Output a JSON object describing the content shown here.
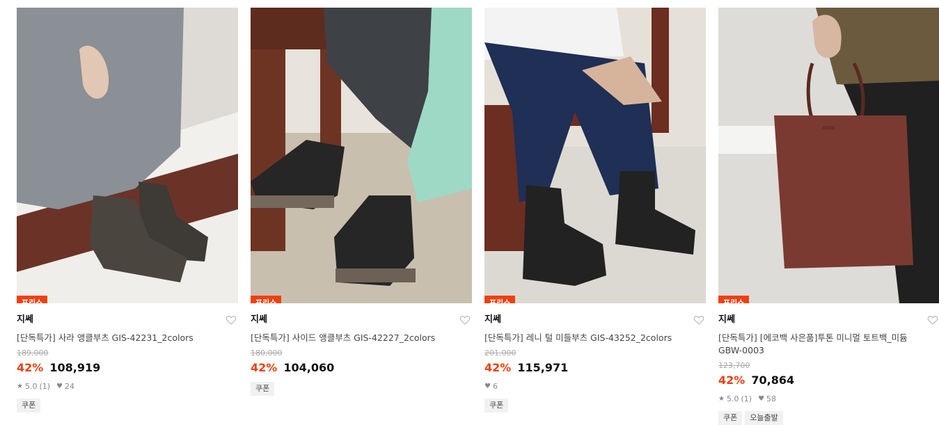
{
  "products": [
    {
      "badge": "프리쇼",
      "brand": "지쎄",
      "name": "[단독특가] 사라 앵클부츠 GIS-42231_2colors",
      "original_price": "189,000",
      "discount": "42%",
      "price": "108,919",
      "rating": "5.0",
      "review_count": "(1)",
      "likes": "24",
      "tags": [
        "쿠폰"
      ],
      "heart_icon": "heart-outline-icon"
    },
    {
      "badge": "프리쇼",
      "brand": "지쎄",
      "name": "[단독특가] 사이드 앵클부츠 GIS-42227_2colors",
      "original_price": "180,000",
      "discount": "42%",
      "price": "104,060",
      "tags": [
        "쿠폰"
      ],
      "heart_icon": "heart-outline-icon"
    },
    {
      "badge": "프리쇼",
      "brand": "지쎄",
      "name": "[단독특가] 레니 털 미들부츠 GIS-43252_2colors",
      "original_price": "201,000",
      "discount": "42%",
      "price": "115,971",
      "likes": "6",
      "tags": [
        "쿠폰"
      ],
      "heart_icon": "heart-outline-icon"
    },
    {
      "badge": "프리쇼",
      "brand": "지쎄",
      "name": "[단독특가] [에코백 사은품]투톤 미니멀 토트백_미듐 GBW-0003",
      "original_price": "123,700",
      "discount": "42%",
      "price": "70,864",
      "rating": "5.0",
      "review_count": "(1)",
      "likes": "58",
      "tags": [
        "쿠폰",
        "오늘출발"
      ],
      "heart_icon": "heart-outline-icon",
      "bag_print": "GISSE"
    }
  ],
  "colors": {
    "accent": "#f0400f",
    "muted": "#888888"
  }
}
